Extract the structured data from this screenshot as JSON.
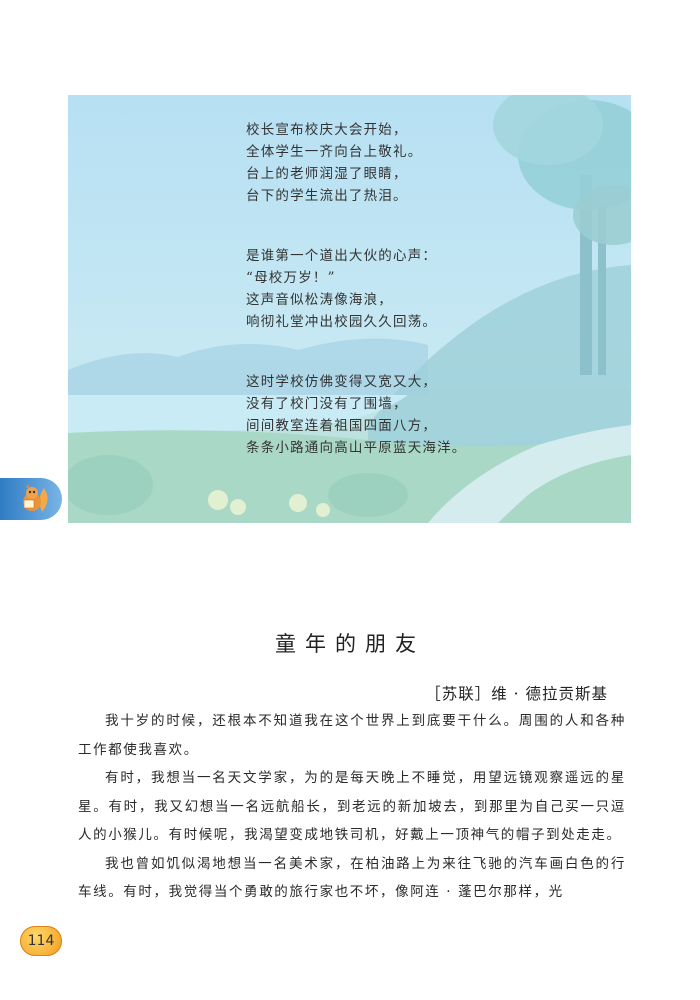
{
  "poem": {
    "stanzas": [
      [
        "校长宣布校庆大会开始，",
        "全体学生一齐向台上敬礼。",
        "台上的老师润湿了眼睛，",
        "台下的学生流出了热泪。"
      ],
      [
        "是谁第一个道出大伙的心声：",
        "“母校万岁！”",
        "这声音似松涛像海浪，",
        "响彻礼堂冲出校园久久回荡。"
      ],
      [
        "这时学校仿佛变得又宽又大，",
        "没有了校门没有了围墙，",
        "间间教室连着祖国四面八方，",
        "条条小路通向高山平原蓝天海洋。"
      ]
    ]
  },
  "article": {
    "title": "童年的朋友",
    "author": "［苏联］维 · 德拉贡斯基",
    "paragraphs": [
      "我十岁的时候，还根本不知道我在这个世界上到底要干什么。周围的人和各种工作都使我喜欢。",
      "有时，我想当一名天文学家，为的是每天晚上不睡觉，用望远镜观察遥远的星星。有时，我又幻想当一名远航船长，到老远的新加坡去，到那里为自己买一只逗人的小猴儿。有时候呢，我渴望变成地铁司机，好戴上一顶神气的帽子到处走走。",
      "我也曾如饥似渴地想当一名美术家，在柏油路上为来往飞驰的汽车画白色的行车线。有时，我觉得当个勇敢的旅行家也不坏，像阿连 · 蓬巴尔那样，光"
    ]
  },
  "page_number": "114",
  "colors": {
    "panel_sky": "#bfe3f2",
    "panel_ground": "#a7d6c9",
    "page_badge": "#f5a623",
    "side_tab": "#3d86cc"
  }
}
